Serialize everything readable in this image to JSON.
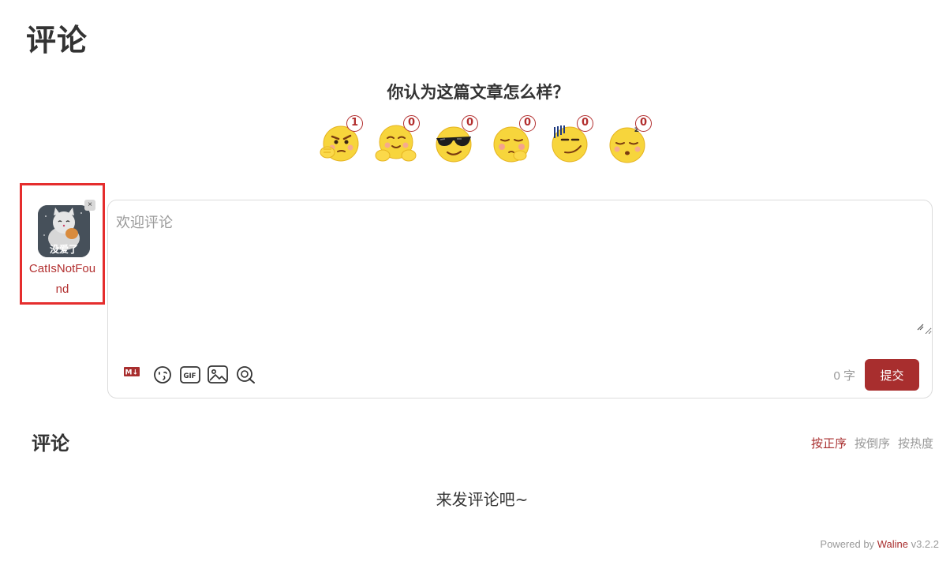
{
  "page": {
    "title": "评论"
  },
  "reactions": {
    "title": "你认为这篇文章怎么样？",
    "items": [
      {
        "name": "thinking",
        "count": "1"
      },
      {
        "name": "hug",
        "count": "0"
      },
      {
        "name": "cool",
        "count": "0"
      },
      {
        "name": "shy",
        "count": "0"
      },
      {
        "name": "speechless",
        "count": "0"
      },
      {
        "name": "sleepy",
        "count": "0"
      }
    ]
  },
  "user": {
    "name": "CatIsNotFound",
    "avatar_caption": "没爱了",
    "close_label": "×"
  },
  "editor": {
    "placeholder": "欢迎评论",
    "word_count": "0 字",
    "submit_label": "提交",
    "tools": [
      "markdown-icon",
      "emoji-icon",
      "gif-icon",
      "image-icon",
      "preview-icon"
    ]
  },
  "comments": {
    "heading": "评论",
    "sort": {
      "asc": "按正序",
      "desc": "按倒序",
      "hot": "按热度"
    },
    "empty": "来发评论吧~"
  },
  "footer": {
    "prefix": "Powered by",
    "brand": "Waline",
    "version": "v3.2.2"
  },
  "colors": {
    "accent": "#a82e2e",
    "highlight_border": "#e52d2d",
    "face": "#f7d53c"
  }
}
